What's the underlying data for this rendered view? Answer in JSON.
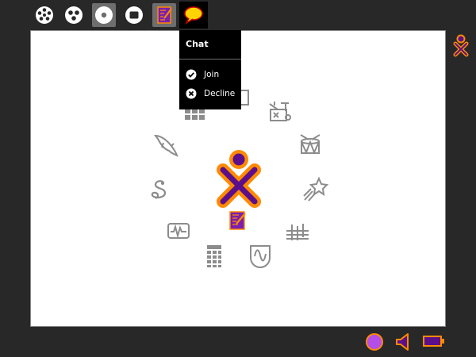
{
  "toolbar": {
    "items": [
      {
        "icon": "neighborhood-icon"
      },
      {
        "icon": "group-icon"
      },
      {
        "icon": "home-icon",
        "selected": true
      },
      {
        "icon": "activity-view-icon"
      },
      {
        "icon": "write-activity-icon"
      },
      {
        "icon": "chat-activity-icon",
        "active": true
      }
    ]
  },
  "palette": {
    "title": "Chat",
    "items": [
      {
        "label": "Join",
        "icon": "checkmark-icon"
      },
      {
        "label": "Decline",
        "icon": "cancel-icon"
      }
    ]
  },
  "home": {
    "center_icon": "xo-buddy-icon",
    "ring_icons": [
      "browse-icon",
      "journal-icon",
      "maze-icon",
      "tamtam-edit-icon",
      "tamtam-mini-icon",
      "starchart-icon",
      "tamtam-synth-icon",
      "measure-icon",
      "calculate-icon",
      "pippy-icon",
      "turtle-icon",
      "dolphin-icon"
    ]
  },
  "frame": {
    "buddy_icon": "xo-buddy-small-icon",
    "tray": [
      "buddy-color-icon",
      "speaker-icon",
      "battery-icon"
    ]
  },
  "colors": {
    "xo_stroke": "#ff8a00",
    "xo_fill": "#5c0f8b",
    "frame_bg": "#282828",
    "chat_fill": "#ffd400",
    "chat_stroke": "#cc0000",
    "tray_purple": "#b44ee8"
  }
}
